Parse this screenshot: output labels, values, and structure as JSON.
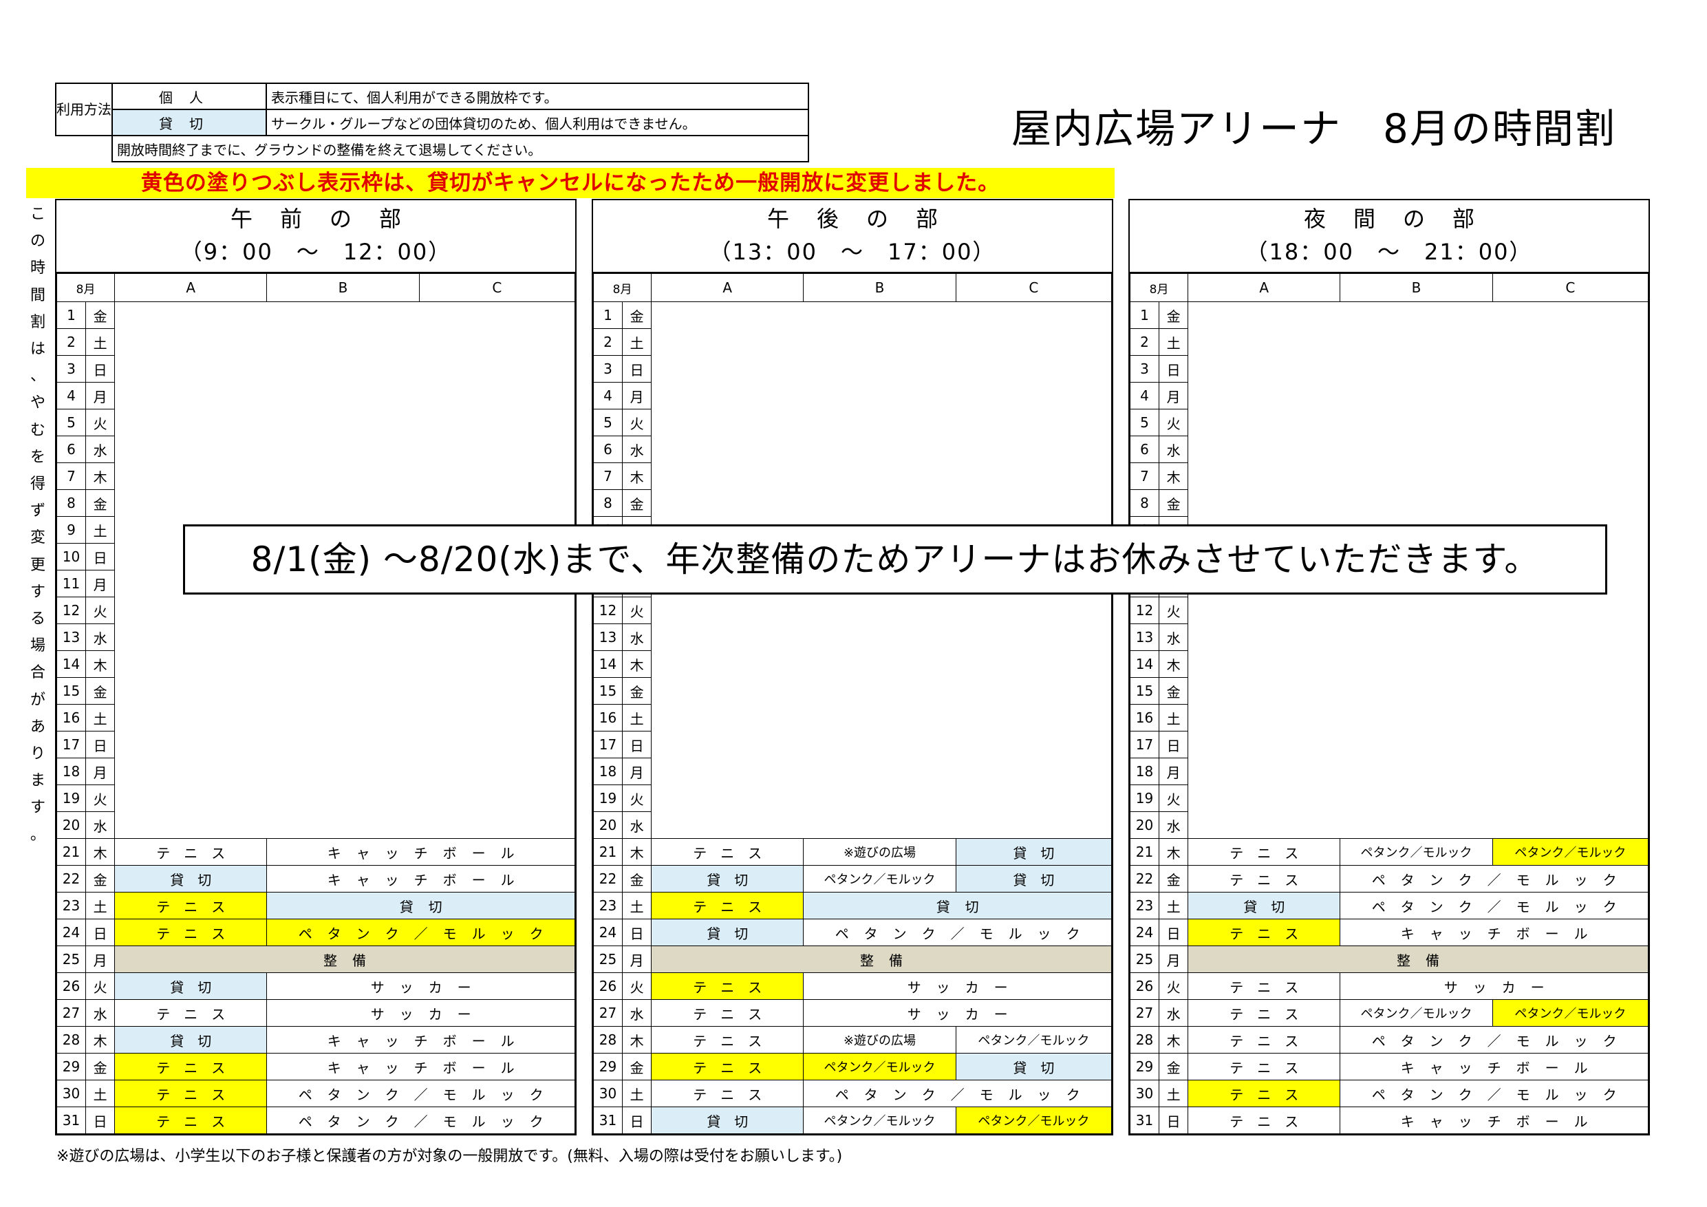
{
  "title": "屋内広場アリーナ　8月の時間割",
  "legend": {
    "label": "利用方法",
    "personal": "個人",
    "personal_desc": "表示種目にて、個人利用ができる開放枠です。",
    "charter": "貸切",
    "charter_desc": "サークル・グループなどの団体貸切のため、個人利用はできません。",
    "ground_note": "開放時間終了までに、グラウンドの整備を終えて退場してください。"
  },
  "yellow_notice": "黄色の塗りつぶし表示枠は、貸切がキャンセルになったため一般開放に変更しました。",
  "side_note": "この時間割は、やむを得ず変更する場合があります。",
  "banner": "8/1(金) ～8/20(水)まで、年次整備のためアリーナはお休みさせていただきます。",
  "footnote": "※遊びの広場は、小学生以下のお子様と保護者の方が対象の一般開放です。(無料、入場の際は受付をお願いします。)",
  "colors": {
    "yellow": "#ffff00",
    "charter_blue": "#dbeef8",
    "maintenance": "#ddd9c4",
    "notice_red": "#e00000"
  },
  "columns": {
    "month": "8月",
    "a": "A",
    "b": "B",
    "c": "C"
  },
  "days": [
    {
      "d": "1",
      "w": "金"
    },
    {
      "d": "2",
      "w": "土"
    },
    {
      "d": "3",
      "w": "日"
    },
    {
      "d": "4",
      "w": "月"
    },
    {
      "d": "5",
      "w": "火"
    },
    {
      "d": "6",
      "w": "水"
    },
    {
      "d": "7",
      "w": "木"
    },
    {
      "d": "8",
      "w": "金"
    },
    {
      "d": "9",
      "w": "土"
    },
    {
      "d": "10",
      "w": "日"
    },
    {
      "d": "11",
      "w": "月"
    },
    {
      "d": "12",
      "w": "火"
    },
    {
      "d": "13",
      "w": "水"
    },
    {
      "d": "14",
      "w": "木"
    },
    {
      "d": "15",
      "w": "金"
    },
    {
      "d": "16",
      "w": "土"
    },
    {
      "d": "17",
      "w": "日"
    },
    {
      "d": "18",
      "w": "月"
    },
    {
      "d": "19",
      "w": "火"
    },
    {
      "d": "20",
      "w": "水"
    },
    {
      "d": "21",
      "w": "木"
    },
    {
      "d": "22",
      "w": "金"
    },
    {
      "d": "23",
      "w": "土"
    },
    {
      "d": "24",
      "w": "日"
    },
    {
      "d": "25",
      "w": "月"
    },
    {
      "d": "26",
      "w": "火"
    },
    {
      "d": "27",
      "w": "水"
    },
    {
      "d": "28",
      "w": "木"
    },
    {
      "d": "29",
      "w": "金"
    },
    {
      "d": "30",
      "w": "土"
    },
    {
      "d": "31",
      "w": "日"
    }
  ],
  "blocks": [
    {
      "name": "午前の部",
      "time": "（9：00　～　12：00）",
      "rows": [
        [
          [
            "テニス",
            "a",
            ""
          ],
          [
            "キャッチボール",
            "bc",
            ""
          ]
        ],
        [
          [
            "貸切",
            "a",
            "bl"
          ],
          [
            "キャッチボール",
            "bc",
            ""
          ]
        ],
        [
          [
            "テニス",
            "a",
            "y"
          ],
          [
            "貸切",
            "bc",
            "bl"
          ]
        ],
        [
          [
            "テニス",
            "a",
            "y"
          ],
          [
            "ペタンク／モルック",
            "bc",
            "y"
          ]
        ],
        [
          [
            "整備",
            "abc",
            "g"
          ]
        ],
        [
          [
            "貸切",
            "a",
            "bl"
          ],
          [
            "サッカー",
            "bc",
            ""
          ]
        ],
        [
          [
            "テニス",
            "a",
            ""
          ],
          [
            "サッカー",
            "bc",
            ""
          ]
        ],
        [
          [
            "貸切",
            "a",
            "bl"
          ],
          [
            "キャッチボール",
            "bc",
            ""
          ]
        ],
        [
          [
            "テニス",
            "a",
            "y"
          ],
          [
            "キャッチボール",
            "bc",
            ""
          ]
        ],
        [
          [
            "テニス",
            "a",
            "y"
          ],
          [
            "ペタンク／モルック",
            "bc",
            ""
          ]
        ],
        [
          [
            "テニス",
            "a",
            "y"
          ],
          [
            "ペタンク／モルック",
            "bc",
            ""
          ]
        ]
      ]
    },
    {
      "name": "午後の部",
      "time": "（13：00　～　17：00）",
      "rows": [
        [
          [
            "テニス",
            "a",
            ""
          ],
          [
            "※遊びの広場",
            "b",
            "sm"
          ],
          [
            "貸切",
            "c",
            "bl"
          ]
        ],
        [
          [
            "貸切",
            "a",
            "bl"
          ],
          [
            "ペタンク／モルック",
            "b",
            "sm"
          ],
          [
            "貸切",
            "c",
            "bl"
          ]
        ],
        [
          [
            "テニス",
            "a",
            "y"
          ],
          [
            "貸切",
            "bc",
            "bl"
          ]
        ],
        [
          [
            "貸切",
            "a",
            "bl"
          ],
          [
            "ペタンク／モルック",
            "bc",
            ""
          ]
        ],
        [
          [
            "整備",
            "abc",
            "g"
          ]
        ],
        [
          [
            "テニス",
            "a",
            "y"
          ],
          [
            "サッカー",
            "bc",
            ""
          ]
        ],
        [
          [
            "テニス",
            "a",
            ""
          ],
          [
            "サッカー",
            "bc",
            ""
          ]
        ],
        [
          [
            "テニス",
            "a",
            ""
          ],
          [
            "※遊びの広場",
            "b",
            "sm"
          ],
          [
            "ペタンク／モルック",
            "c",
            "sm"
          ]
        ],
        [
          [
            "テニス",
            "a",
            "y"
          ],
          [
            "ペタンク／モルック",
            "b",
            "y sm"
          ],
          [
            "貸切",
            "c",
            "bl"
          ]
        ],
        [
          [
            "テニス",
            "a",
            ""
          ],
          [
            "ペタンク／モルック",
            "bc",
            ""
          ]
        ],
        [
          [
            "貸切",
            "a",
            "bl"
          ],
          [
            "ペタンク／モルック",
            "b",
            "sm"
          ],
          [
            "ペタンク／モルック",
            "c",
            "y sm"
          ]
        ]
      ]
    },
    {
      "name": "夜間の部",
      "time": "（18：00　～　21：00）",
      "rows": [
        [
          [
            "テニス",
            "a",
            ""
          ],
          [
            "ペタンク／モルック",
            "b",
            "sm"
          ],
          [
            "ペタンク／モルック",
            "c",
            "y sm"
          ]
        ],
        [
          [
            "テニス",
            "a",
            ""
          ],
          [
            "ペタンク／モルック",
            "bc",
            ""
          ]
        ],
        [
          [
            "貸切",
            "a",
            "bl"
          ],
          [
            "ペタンク／モルック",
            "bc",
            ""
          ]
        ],
        [
          [
            "テニス",
            "a",
            "y"
          ],
          [
            "キャッチボール",
            "bc",
            ""
          ]
        ],
        [
          [
            "整備",
            "abc",
            "g"
          ]
        ],
        [
          [
            "テニス",
            "a",
            ""
          ],
          [
            "サッカー",
            "bc",
            ""
          ]
        ],
        [
          [
            "テニス",
            "a",
            ""
          ],
          [
            "ペタンク／モルック",
            "b",
            "sm"
          ],
          [
            "ペタンク／モルック",
            "c",
            "y sm"
          ]
        ],
        [
          [
            "テニス",
            "a",
            ""
          ],
          [
            "ペタンク／モルック",
            "bc",
            ""
          ]
        ],
        [
          [
            "テニス",
            "a",
            ""
          ],
          [
            "キャッチボール",
            "bc",
            ""
          ]
        ],
        [
          [
            "テニス",
            "a",
            "y"
          ],
          [
            "ペタンク／モルック",
            "bc",
            ""
          ]
        ],
        [
          [
            "テニス",
            "a",
            ""
          ],
          [
            "キャッチボール",
            "bc",
            ""
          ]
        ]
      ]
    }
  ]
}
